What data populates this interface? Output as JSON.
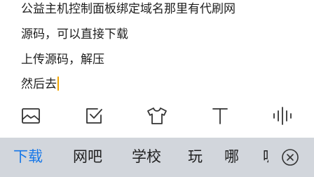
{
  "editor": {
    "lines": [
      "公益主机控制面板绑定域名那里有代刷网",
      "源码，可以直接下载",
      "上传源码，解压",
      "然后去"
    ]
  },
  "toolbar": {
    "icons": [
      "image-icon",
      "checkbox-icon",
      "tshirt-icon",
      "text-format-icon",
      "voice-icon"
    ]
  },
  "candidates": {
    "items": [
      "下载",
      "网吧",
      "学校",
      "玩",
      "哪",
      "呢"
    ],
    "close_icon": "close-circle-icon"
  },
  "colors": {
    "primary_candidate": "#1677e8",
    "caret": "#f0a500",
    "candidate_bar_bg": "#d2d6dc"
  }
}
